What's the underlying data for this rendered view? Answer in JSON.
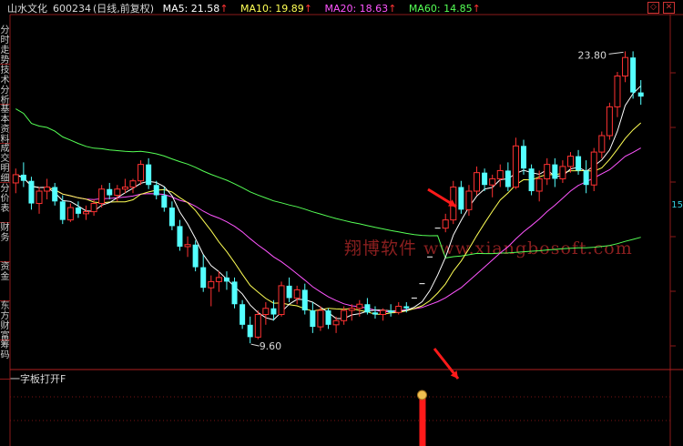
{
  "window": {
    "stock_name": "山水文化",
    "stock_code": "600234",
    "period": "(日线,前复权)"
  },
  "indicators": [
    {
      "label": "MA5: 21.58",
      "color": "#ffffff"
    },
    {
      "label": "MA10: 19.89",
      "color": "#ffff55"
    },
    {
      "label": "MA20: 18.63",
      "color": "#ff55ff"
    },
    {
      "label": "MA60: 14.85",
      "color": "#55ff55"
    }
  ],
  "side_tabs": [
    "分时走势",
    "技术分析",
    "基本资料",
    "成交明细",
    "分价表",
    "财务",
    "资金",
    "东方财富",
    "筹码"
  ],
  "sub_panel": {
    "title": "一字板打开F"
  },
  "watermark": "翔博软件  www.xiangbosoft.com",
  "right_axis_label": "15",
  "chart_data": {
    "type": "candlestick",
    "annotations": [
      {
        "text": "23.80",
        "kind": "high"
      },
      {
        "text": "9.60",
        "kind": "low"
      }
    ],
    "ylim": [
      8.5,
      25.5
    ],
    "candles": [
      [
        17.4,
        18.1,
        16.9,
        17.8
      ],
      [
        17.8,
        18.4,
        17.2,
        17.5
      ],
      [
        17.5,
        17.7,
        16.1,
        16.4
      ],
      [
        16.4,
        17.2,
        15.9,
        17.0
      ],
      [
        17.0,
        17.6,
        16.6,
        17.2
      ],
      [
        17.2,
        17.4,
        16.3,
        16.5
      ],
      [
        16.5,
        16.8,
        15.4,
        15.6
      ],
      [
        15.6,
        16.4,
        15.5,
        16.2
      ],
      [
        16.2,
        16.5,
        15.7,
        15.9
      ],
      [
        15.9,
        16.3,
        15.6,
        16.0
      ],
      [
        16.0,
        16.6,
        15.8,
        16.4
      ],
      [
        16.4,
        17.3,
        16.2,
        17.1
      ],
      [
        17.1,
        17.4,
        16.6,
        16.8
      ],
      [
        16.8,
        17.3,
        16.5,
        17.1
      ],
      [
        17.1,
        17.6,
        16.9,
        17.2
      ],
      [
        17.2,
        17.6,
        16.9,
        17.5
      ],
      [
        17.5,
        18.5,
        17.3,
        18.3
      ],
      [
        18.3,
        18.6,
        17.1,
        17.3
      ],
      [
        17.3,
        17.5,
        16.6,
        16.8
      ],
      [
        16.8,
        17.2,
        16.0,
        16.2
      ],
      [
        16.2,
        16.5,
        15.1,
        15.3
      ],
      [
        15.3,
        15.6,
        14.1,
        14.3
      ],
      [
        14.3,
        14.8,
        13.8,
        14.4
      ],
      [
        14.4,
        14.6,
        13.1,
        13.3
      ],
      [
        13.3,
        13.9,
        12.1,
        12.3
      ],
      [
        12.3,
        12.9,
        11.4,
        12.6
      ],
      [
        12.6,
        13.1,
        12.1,
        12.8
      ],
      [
        12.8,
        13.1,
        12.2,
        12.6
      ],
      [
        12.6,
        12.8,
        11.3,
        11.5
      ],
      [
        11.5,
        11.7,
        10.3,
        10.5
      ],
      [
        10.5,
        10.9,
        9.6,
        9.9
      ],
      [
        9.9,
        11.2,
        9.8,
        11.0
      ],
      [
        11.0,
        11.6,
        10.5,
        11.3
      ],
      [
        11.3,
        11.7,
        10.7,
        11.0
      ],
      [
        11.0,
        12.6,
        10.9,
        12.4
      ],
      [
        12.4,
        12.8,
        11.6,
        11.8
      ],
      [
        11.8,
        12.4,
        11.5,
        12.2
      ],
      [
        12.2,
        12.5,
        11.0,
        11.2
      ],
      [
        11.2,
        11.6,
        10.1,
        10.4
      ],
      [
        10.4,
        11.4,
        10.2,
        11.2
      ],
      [
        11.2,
        11.3,
        10.3,
        10.5
      ],
      [
        10.5,
        10.9,
        10.1,
        10.7
      ],
      [
        10.7,
        11.4,
        10.5,
        11.2
      ],
      [
        11.2,
        11.5,
        10.7,
        11.3
      ],
      [
        11.3,
        11.7,
        10.9,
        11.5
      ],
      [
        11.5,
        11.8,
        11.0,
        11.1
      ],
      [
        11.1,
        11.4,
        10.8,
        11.0
      ],
      [
        11.0,
        11.3,
        10.7,
        11.2
      ],
      [
        11.2,
        11.5,
        10.9,
        11.1
      ],
      [
        11.1,
        11.6,
        11.0,
        11.4
      ],
      [
        11.4,
        11.6,
        11.1,
        11.3
      ],
      [
        11.8,
        11.8,
        11.8,
        11.8
      ],
      [
        12.5,
        12.5,
        12.5,
        12.5
      ],
      [
        13.8,
        13.8,
        13.8,
        13.8
      ],
      [
        15.2,
        15.2,
        15.2,
        15.2
      ],
      [
        15.2,
        15.9,
        15.0,
        15.6
      ],
      [
        15.6,
        17.5,
        15.4,
        17.2
      ],
      [
        17.2,
        17.5,
        15.9,
        16.1
      ],
      [
        16.1,
        17.3,
        15.8,
        17.0
      ],
      [
        17.0,
        18.2,
        16.8,
        17.9
      ],
      [
        17.9,
        18.1,
        17.0,
        17.3
      ],
      [
        17.3,
        17.8,
        16.7,
        17.6
      ],
      [
        17.6,
        18.3,
        17.2,
        18.0
      ],
      [
        18.0,
        18.4,
        17.0,
        17.2
      ],
      [
        17.2,
        19.6,
        17.1,
        19.2
      ],
      [
        19.2,
        19.5,
        17.8,
        18.1
      ],
      [
        18.1,
        18.3,
        16.8,
        17.0
      ],
      [
        17.0,
        18.0,
        16.5,
        17.6
      ],
      [
        17.6,
        18.6,
        17.3,
        18.3
      ],
      [
        18.3,
        18.6,
        17.2,
        17.6
      ],
      [
        17.6,
        18.5,
        17.4,
        18.2
      ],
      [
        18.2,
        18.9,
        17.9,
        18.7
      ],
      [
        18.7,
        19.0,
        17.8,
        18.0
      ],
      [
        18.0,
        18.5,
        16.9,
        17.3
      ],
      [
        17.3,
        19.1,
        17.0,
        18.9
      ],
      [
        18.9,
        19.9,
        18.6,
        19.7
      ],
      [
        19.7,
        21.3,
        19.5,
        21.1
      ],
      [
        21.1,
        22.8,
        20.6,
        22.6
      ],
      [
        22.6,
        23.8,
        22.3,
        23.5
      ],
      [
        23.5,
        23.8,
        21.5,
        21.8
      ],
      [
        21.8,
        22.4,
        21.2,
        21.6
      ]
    ]
  }
}
